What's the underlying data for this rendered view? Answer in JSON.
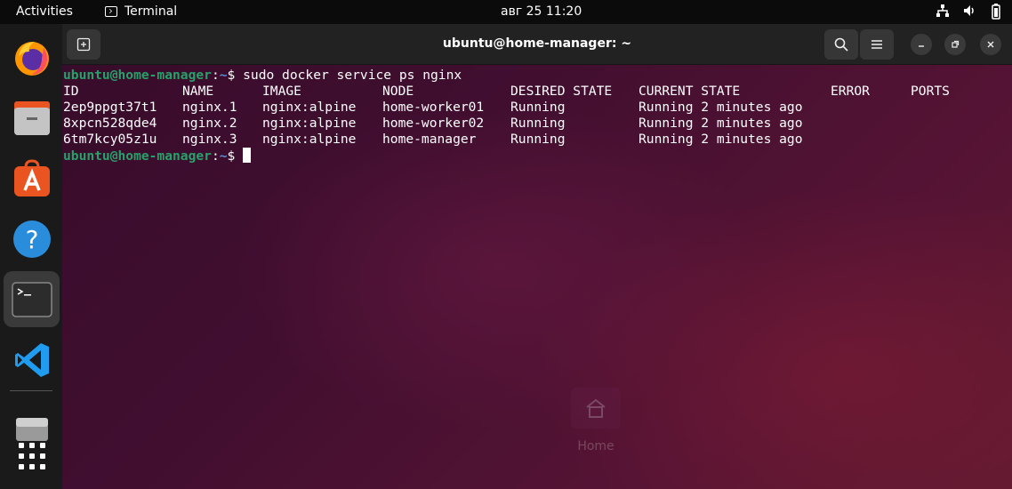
{
  "topbar": {
    "activities": "Activities",
    "app_name": "Terminal",
    "clock": "авг 25  11:20"
  },
  "window": {
    "title": "ubuntu@home-manager: ~"
  },
  "prompt": {
    "user_host": "ubuntu@home-manager",
    "path": "~",
    "symbol": "$"
  },
  "command": "sudo docker service ps nginx",
  "table": {
    "headers": [
      "ID",
      "NAME",
      "IMAGE",
      "NODE",
      "DESIRED STATE",
      "CURRENT STATE",
      "ERROR",
      "PORTS"
    ],
    "rows": [
      [
        "2ep9ppgt37t1",
        "nginx.1",
        "nginx:alpine",
        "home-worker01",
        "Running",
        "Running 2 minutes ago",
        "",
        ""
      ],
      [
        "8xpcn528qde4",
        "nginx.2",
        "nginx:alpine",
        "home-worker02",
        "Running",
        "Running 2 minutes ago",
        "",
        ""
      ],
      [
        "6tm7kcy05z1u",
        "nginx.3",
        "nginx:alpine",
        "home-manager",
        "Running",
        "Running 2 minutes ago",
        "",
        ""
      ]
    ]
  },
  "desktop": {
    "home_label": "Home"
  },
  "dock": {
    "items": [
      "firefox-icon",
      "files-icon",
      "software-icon",
      "help-icon",
      "terminal-icon",
      "vscode-icon",
      "disk-icon",
      "app-grid-icon"
    ]
  },
  "colors": {
    "accent": "#e95420",
    "prompt_user": "#26a269",
    "prompt_path": "#5c8ed6"
  }
}
